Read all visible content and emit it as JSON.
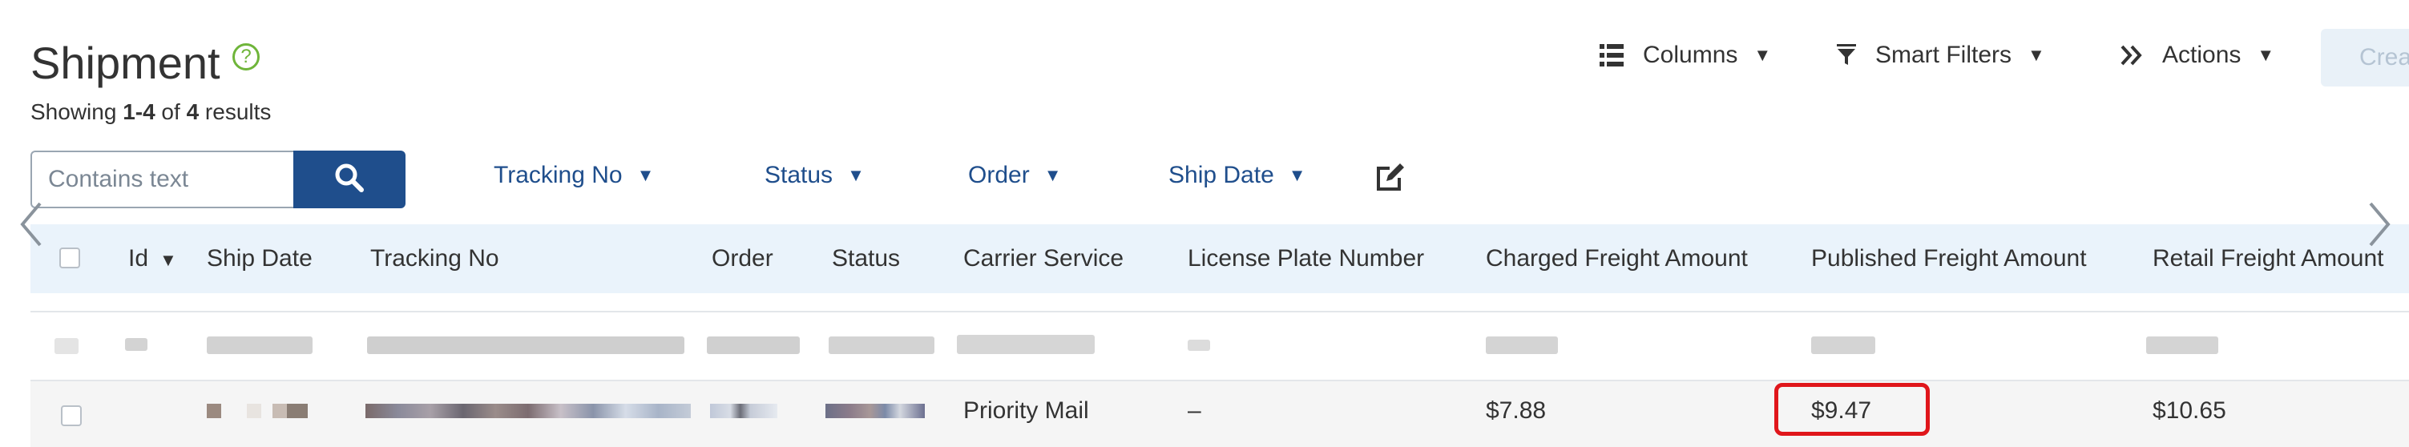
{
  "page": {
    "title": "Shipment",
    "results_prefix": "Showing ",
    "results_range": "1-4",
    "results_of": " of ",
    "results_total": "4",
    "results_suffix": " results"
  },
  "toolbar": {
    "columns_label": "Columns",
    "smart_filters_label": "Smart Filters",
    "actions_label": "Actions",
    "create_label": "Crea"
  },
  "search": {
    "placeholder": "Contains text"
  },
  "filters": [
    {
      "label": "Tracking No"
    },
    {
      "label": "Status"
    },
    {
      "label": "Order"
    },
    {
      "label": "Ship Date"
    }
  ],
  "table": {
    "columns": [
      "Id",
      "Ship Date",
      "Tracking No",
      "Order",
      "Status",
      "Carrier Service",
      "License Plate Number",
      "Charged Freight Amount",
      "Published Freight Amount",
      "Retail Freight Amount"
    ],
    "rows": [
      {
        "carrier_service": "Priority Mail",
        "license_plate": "–",
        "charged": "$7.88",
        "published": "$9.47",
        "retail": "$10.65"
      }
    ]
  },
  "icons": {
    "help": "help-circle-icon",
    "columns": "list-icon",
    "smart_filters": "funnel-icon",
    "actions": "double-chevron-right-icon",
    "search": "search-icon",
    "edit": "edit-icon",
    "sort": "caret-down-icon",
    "scroll_left": "chevron-left-icon",
    "scroll_right": "chevron-right-icon"
  },
  "colors": {
    "accent": "#1f4e8c",
    "header_bg": "#eaf3fb",
    "help_green": "#6fb53a",
    "highlight_red": "#e0161b"
  }
}
